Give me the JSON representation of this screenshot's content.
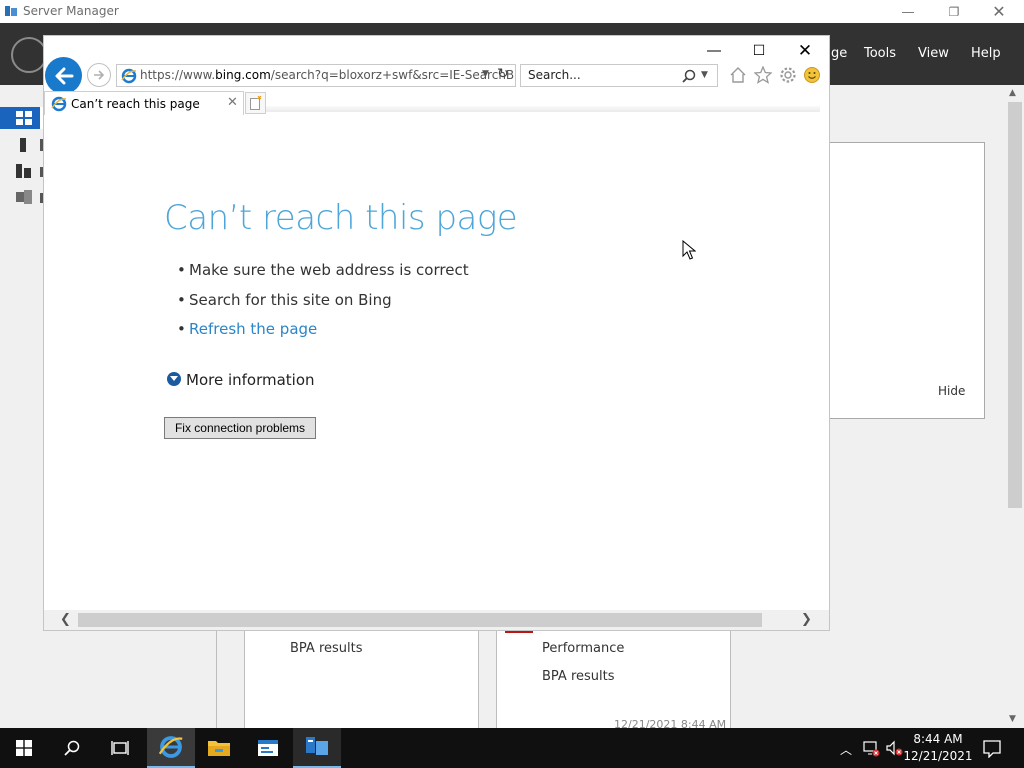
{
  "server_manager": {
    "title": "Server Manager",
    "menu": [
      "ge",
      "Tools",
      "View",
      "Help"
    ],
    "welcome_hide": "Hide",
    "tile1": {
      "line1": "BPA results"
    },
    "tile2": {
      "line1": "Performance",
      "line2": "BPA results"
    },
    "timestamp": "12/21/2021 8:44 AM"
  },
  "ie": {
    "url_prefix": "https://www.",
    "url_host": "bing.com",
    "url_rest": "/search?q=bloxorz+swf&src=IE-SearchB",
    "search_placeholder": "Search...",
    "tab_title": "Can’t reach this page"
  },
  "error_page": {
    "title": "Can’t reach this page",
    "bullets": [
      "Make sure the web address is correct",
      "Search for this site on Bing"
    ],
    "refresh_link": "Refresh the page",
    "more_info": "More information",
    "fix_button": "Fix connection problems"
  },
  "taskbar": {
    "time": "8:44 AM",
    "date": "12/21/2021"
  },
  "colors": {
    "accent": "#1979ca",
    "error_title": "#4da5d8",
    "link": "#2a86c8",
    "taskbar": "#101010",
    "sm_header": "#323232"
  }
}
